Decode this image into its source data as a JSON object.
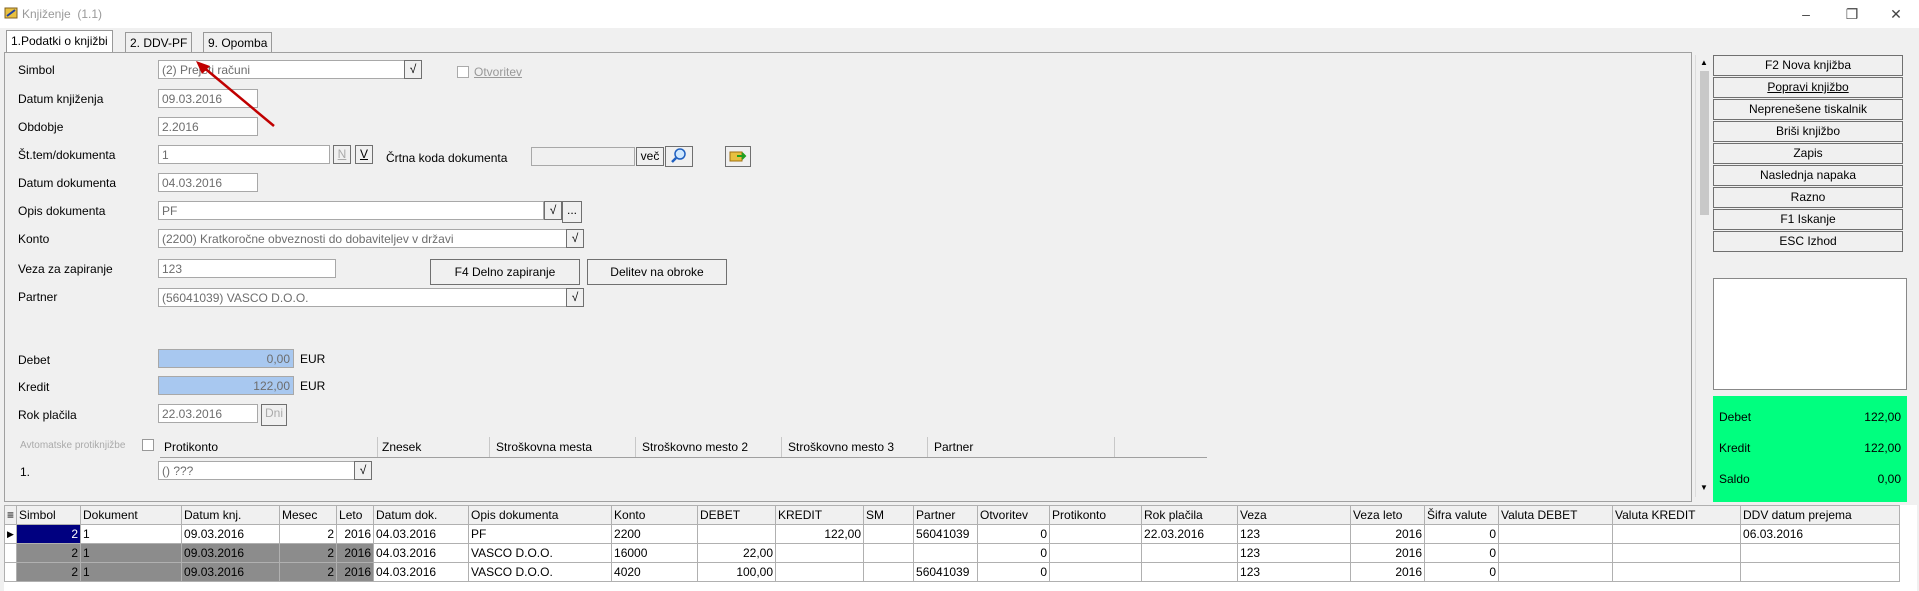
{
  "window": {
    "title": "Knjiženje",
    "version": "(1.1)"
  },
  "tabs": [
    "1.Podatki o knjižbi",
    "2. DDV-PF",
    "9. Opomba"
  ],
  "form": {
    "simbol_label": "Simbol",
    "simbol_value": "(2) Prejeti računi",
    "otvoritev_label": "Otvoritev",
    "datum_knjizenja_label": "Datum knjiženja",
    "datum_knjizenja_value": "09.03.2016",
    "obdobje_label": "Obdobje",
    "obdobje_value": "2.2016",
    "st_tem_label": "Št.tem/dokumenta",
    "st_tem_value": "1",
    "n_btn": "N",
    "v_btn": "V",
    "crtna_label": "Črtna koda dokumenta",
    "vec_btn": "več",
    "datum_dok_label": "Datum dokumenta",
    "datum_dok_value": "04.03.2016",
    "opis_label": "Opis dokumenta",
    "opis_value": "PF",
    "konto_label": "Konto",
    "konto_value": "(2200) Kratkoročne obveznosti do dobaviteljev v državi",
    "veza_label": "Veza za zapiranje",
    "veza_value": "123",
    "f4_btn": "F4 Delno zapiranje",
    "delitev_btn": "Delitev na obroke",
    "partner_label": "Partner",
    "partner_value": "(56041039) VASCO D.O.O.",
    "debet_label": "Debet",
    "debet_value": "0,00",
    "currency": "EUR",
    "kredit_label": "Kredit",
    "kredit_value": "122,00",
    "rok_label": "Rok plačila",
    "rok_value": "22.03.2016",
    "dni_btn": "Dni",
    "avto_label": "Avtomatske protiknjižbe",
    "cols": [
      "Protikonto",
      "Znesek",
      "Stroškovna mesta",
      "Stroškovno mesto 2",
      "Stroškovno mesto 3",
      "Partner"
    ],
    "row1_label": "1.",
    "row1_value": "() ???",
    "check": "√",
    "ellipsis": "..."
  },
  "right_buttons": [
    "F2 Nova knjižba",
    "Popravi knjižbo",
    "Neprenešene tiskalnik",
    "Briši knjižbo",
    "Zapis",
    "Naslednja napaka",
    "Razno",
    "F1 Iskanje",
    "ESC Izhod"
  ],
  "summary": {
    "debet_label": "Debet",
    "debet": "122,00",
    "kredit_label": "Kredit",
    "kredit": "122,00",
    "saldo_label": "Saldo",
    "saldo": "0,00"
  },
  "grid": {
    "headers": [
      "Simbol",
      "Dokument",
      "Datum knj.",
      "Mesec",
      "Leto",
      "Datum dok.",
      "Opis dokumenta",
      "Konto",
      "DEBET",
      "KREDIT",
      "SM",
      "Partner",
      "Otvoritev",
      "Protikonto",
      "Rok plačila",
      "Veza",
      "Veza leto",
      "Šifra valute",
      "Valuta DEBET",
      "Valuta KREDIT",
      "DDV datum prejema"
    ],
    "rows": [
      [
        "2",
        "1",
        "09.03.2016",
        "2",
        "2016",
        "04.03.2016",
        "PF",
        "2200",
        "",
        "122,00",
        "",
        "56041039",
        "0",
        "",
        "22.03.2016",
        "123",
        "2016",
        "0",
        "",
        "",
        "06.03.2016"
      ],
      [
        "2",
        "1",
        "09.03.2016",
        "2",
        "2016",
        "04.03.2016",
        "VASCO D.O.O.",
        "16000",
        "22,00",
        "",
        "",
        "",
        "0",
        "",
        "",
        "123",
        "2016",
        "0",
        "",
        "",
        ""
      ],
      [
        "2",
        "1",
        "09.03.2016",
        "2",
        "2016",
        "04.03.2016",
        "VASCO D.O.O.",
        "4020",
        "100,00",
        "",
        "",
        "56041039",
        "0",
        "",
        "",
        "123",
        "2016",
        "0",
        "",
        "",
        ""
      ]
    ]
  }
}
